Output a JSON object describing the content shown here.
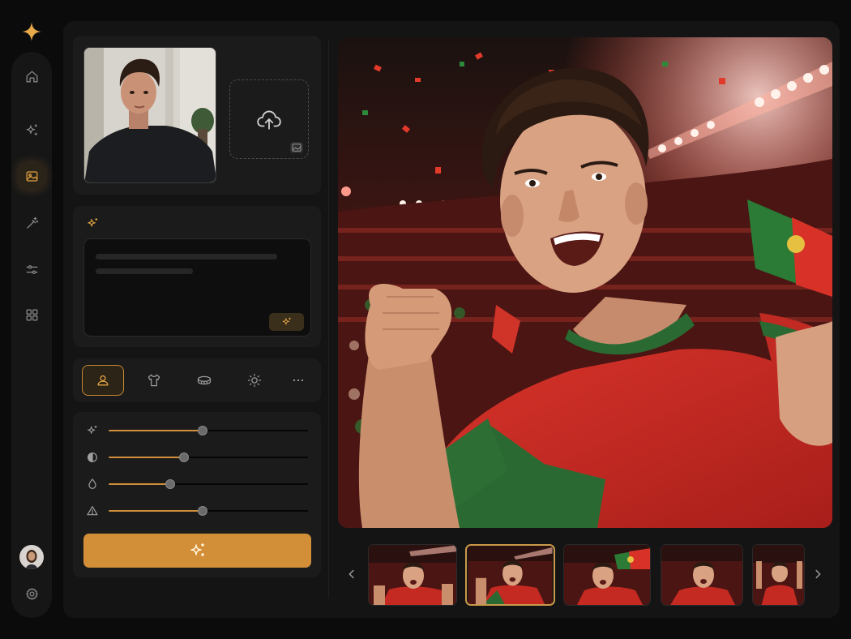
{
  "app": {
    "logo_icon": "sparkle-logo-icon",
    "accent": "#d38f37"
  },
  "sidebar": {
    "items": [
      {
        "name": "home",
        "icon": "home-icon",
        "active": false
      },
      {
        "name": "ai-generate",
        "icon": "sparkles-icon",
        "active": false
      },
      {
        "name": "image",
        "icon": "image-icon",
        "active": true
      },
      {
        "name": "magic-edit",
        "icon": "magic-wand-icon",
        "active": false
      },
      {
        "name": "adjust",
        "icon": "sliders-icon",
        "active": false
      },
      {
        "name": "gallery",
        "icon": "grid-icon",
        "active": false
      }
    ],
    "bottom": [
      {
        "name": "profile",
        "icon": "avatar"
      },
      {
        "name": "settings",
        "icon": "gear-icon"
      }
    ]
  },
  "reference": {
    "upload_icon": "cloud-upload-icon",
    "mini_icon": "image-icon"
  },
  "prompt": {
    "header_icon": "sparkles-icon",
    "enhance_icon": "sparkles-icon"
  },
  "tabs": [
    {
      "name": "person",
      "icon": "person-icon",
      "active": true
    },
    {
      "name": "clothing",
      "icon": "tshirt-icon",
      "active": false
    },
    {
      "name": "ring",
      "icon": "ring-icon",
      "active": false
    },
    {
      "name": "lighting",
      "icon": "sun-icon",
      "active": false
    },
    {
      "name": "more",
      "icon": "more-icon",
      "active": false
    }
  ],
  "sliders": [
    {
      "name": "enhance",
      "icon": "sparkles-icon",
      "value": 0.47
    },
    {
      "name": "contrast",
      "icon": "contrast-icon",
      "value": 0.38
    },
    {
      "name": "saturation",
      "icon": "droplet-icon",
      "value": 0.31
    },
    {
      "name": "sharpness",
      "icon": "triangle-icon",
      "value": 0.47
    }
  ],
  "generate": {
    "icon": "sparkles-icon"
  },
  "filmstrip": {
    "selected_index": 1,
    "count": 5
  }
}
